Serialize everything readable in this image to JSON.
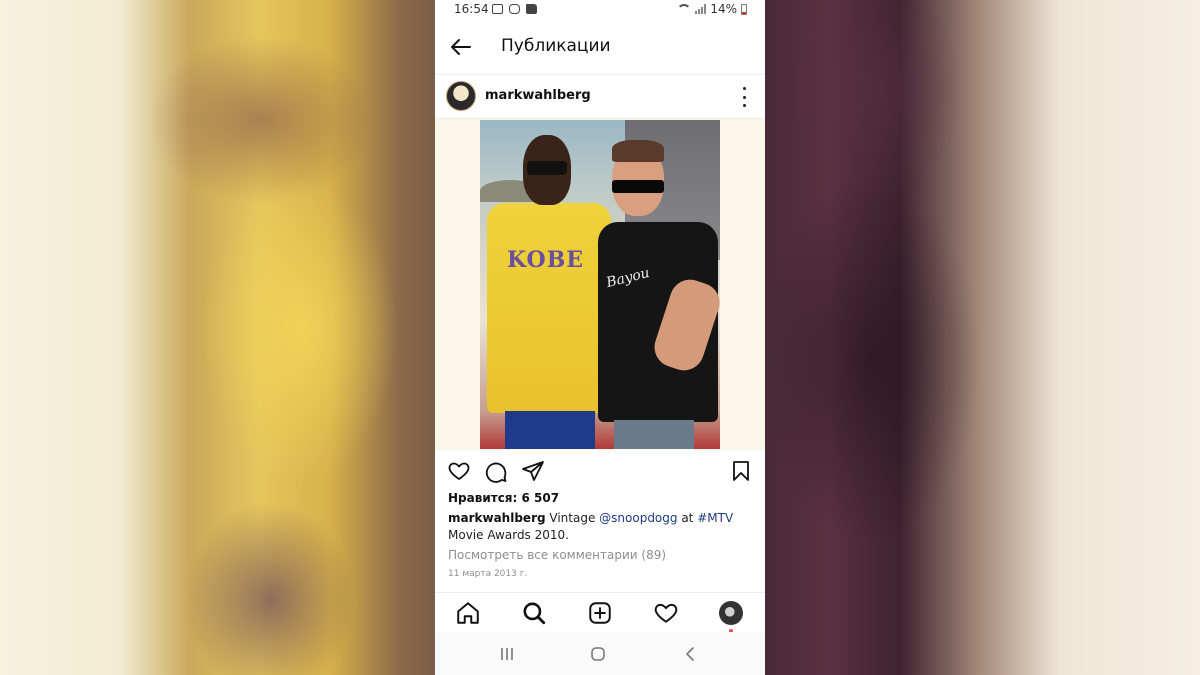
{
  "status_bar": {
    "time": "16:54",
    "battery": "14%"
  },
  "header": {
    "title": "Публикации"
  },
  "post": {
    "username": "markwahlberg",
    "likes": "Нравится: 6 507",
    "caption": {
      "username": "markwahlberg",
      "text_1": " Vintage ",
      "mention": "@snoopdogg",
      "text_2": " at ",
      "hashtag": "#MTV",
      "text_3": " Movie Awards 2010."
    },
    "comments_link": "Посмотреть все комментарии (89)",
    "date": "11 марта 2013 г.",
    "photo": {
      "shirt_text_1": "KOBE",
      "shirt_text_2": "Bayou"
    }
  },
  "icons": {
    "back": "arrow-left-icon",
    "more": "more-vertical-icon",
    "like": "heart-icon",
    "comment": "comment-icon",
    "share": "send-icon",
    "save": "bookmark-icon",
    "home": "home-icon",
    "search": "search-icon",
    "add": "add-post-icon",
    "activity": "heart-icon",
    "profile": "profile-avatar"
  },
  "colors": {
    "accent_link": "#1e3c86",
    "notification_dot": "#ed4956",
    "muted_text": "#8e8e8e"
  }
}
